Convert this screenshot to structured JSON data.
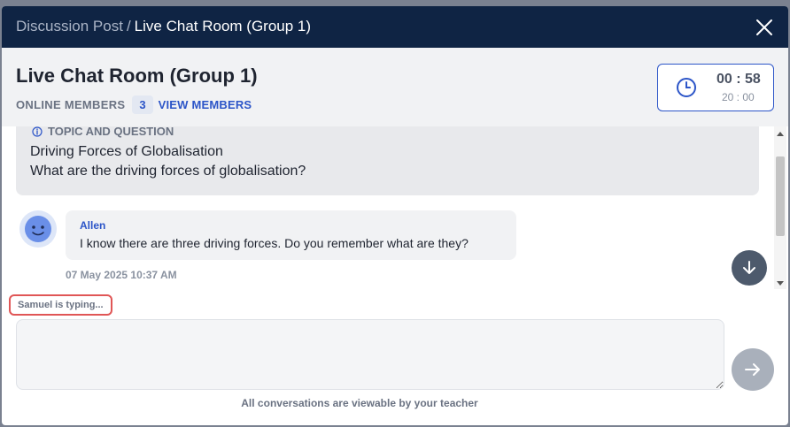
{
  "breadcrumb": {
    "parent": "Discussion Post",
    "separator": "/",
    "current": "Live Chat Room (Group 1)"
  },
  "header": {
    "room_title": "Live Chat Room (Group 1)",
    "online_members_label": "ONLINE MEMBERS",
    "online_members_count": "3",
    "view_members_label": "VIEW MEMBERS"
  },
  "timer": {
    "elapsed": "00 : 58",
    "total": "20 : 00",
    "icon": "clock-icon"
  },
  "topic": {
    "heading": "TOPIC AND QUESTION",
    "title": "Driving Forces of Globalisation",
    "question": "What are the driving forces of globalisation?"
  },
  "messages": [
    {
      "author": "Allen",
      "text": "I know there are three driving forces. Do you remember what are they?",
      "timestamp": "07 May 2025 10:37 AM"
    }
  ],
  "typing_indicator": "Samuel is typing...",
  "compose": {
    "placeholder": ""
  },
  "footer_note": "All conversations are viewable by your teacher",
  "colors": {
    "topbar": "#0f2444",
    "accent": "#2c55c8",
    "typing_border": "#e05656"
  }
}
